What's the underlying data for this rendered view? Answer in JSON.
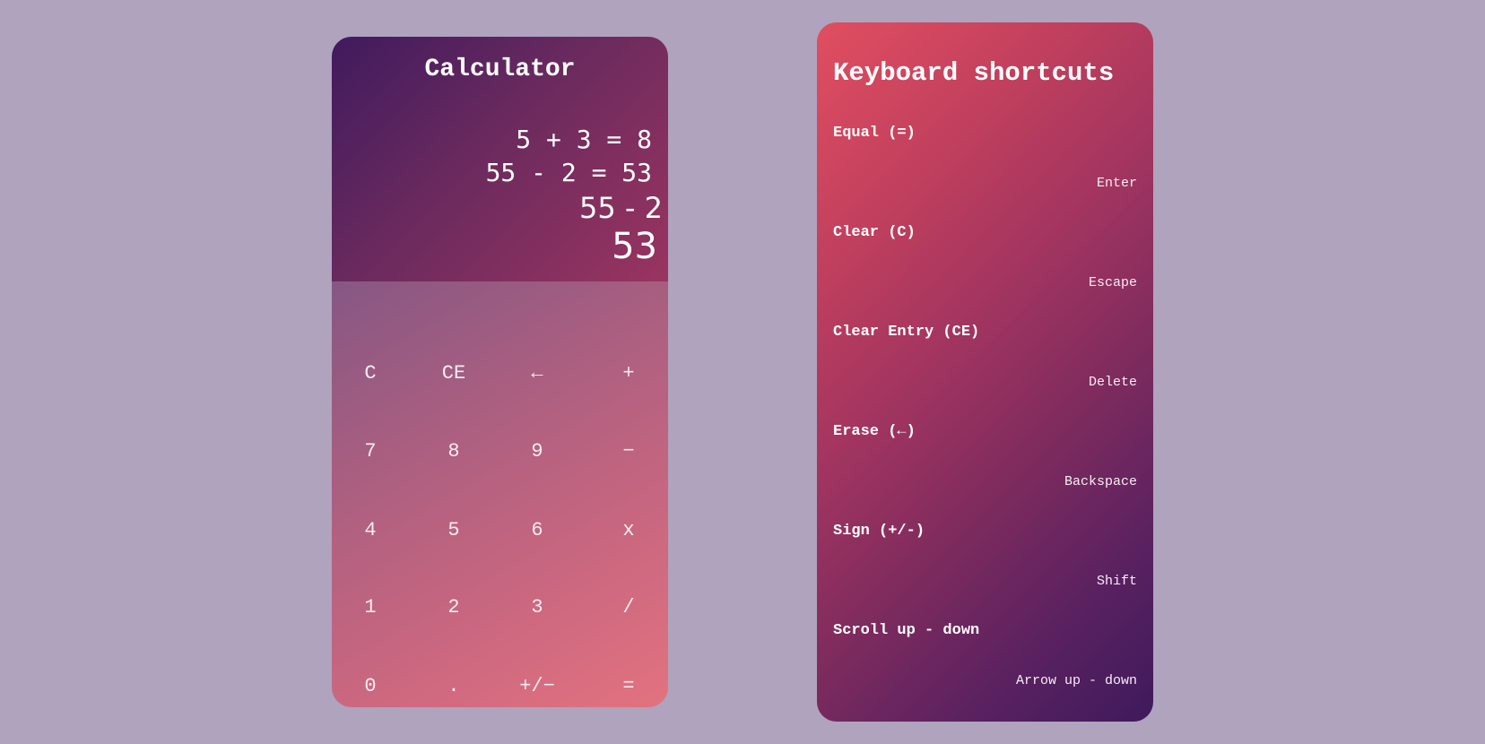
{
  "calculator": {
    "title": "Calculator",
    "history": [
      "5 + 3 = 8",
      "55 - 2 = 53"
    ],
    "expression": "55 - 2",
    "result": "53",
    "keys": [
      [
        "C",
        "CE",
        "←",
        "+"
      ],
      [
        "7",
        "8",
        "9",
        "−"
      ],
      [
        "4",
        "5",
        "6",
        "x"
      ],
      [
        "1",
        "2",
        "3",
        "/"
      ],
      [
        "0",
        ".",
        "+/−",
        "="
      ]
    ]
  },
  "shortcuts": {
    "title": "Keyboard shortcuts",
    "items": [
      {
        "name": "Equal (=)",
        "key": "Enter"
      },
      {
        "name": "Clear (C)",
        "key": "Escape"
      },
      {
        "name": "Clear Entry (CE)",
        "key": "Delete"
      },
      {
        "name": "Erase (←)",
        "key": "Backspace"
      },
      {
        "name": "Sign (+/-)",
        "key": "Shift"
      },
      {
        "name": "Scroll up - down",
        "key": "Arrow up - down"
      }
    ]
  }
}
